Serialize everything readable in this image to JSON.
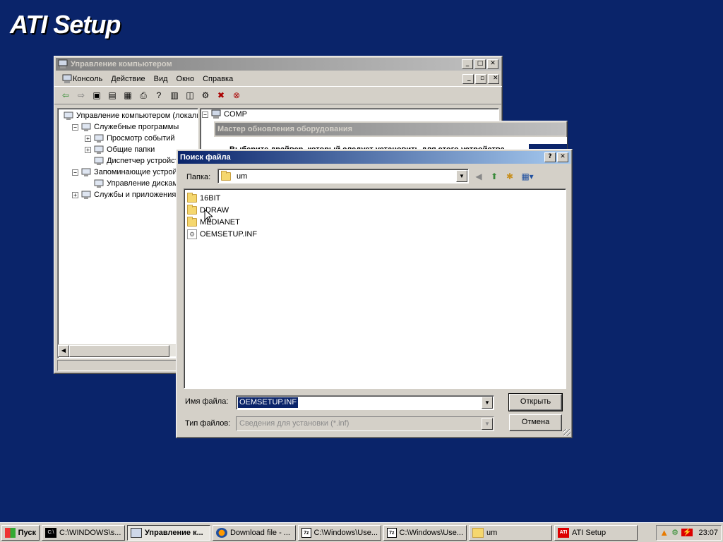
{
  "desktop": {
    "banner": "ATI Setup"
  },
  "mmc": {
    "title": "Управление компьютером",
    "menu": [
      "Консоль",
      "Действие",
      "Вид",
      "Окно",
      "Справка"
    ],
    "tree": [
      {
        "label": "Управление компьютером (локаль",
        "level": 0,
        "expander": ""
      },
      {
        "label": "Служебные программы",
        "level": 1,
        "expander": "−"
      },
      {
        "label": "Просмотр событий",
        "level": 2,
        "expander": "+"
      },
      {
        "label": "Общие папки",
        "level": 2,
        "expander": "+"
      },
      {
        "label": "Диспетчер устройств",
        "level": 2,
        "expander": ""
      },
      {
        "label": "Запоминающие устройства",
        "level": 1,
        "expander": "−"
      },
      {
        "label": "Управление дисками",
        "level": 2,
        "expander": ""
      },
      {
        "label": "Службы и приложения",
        "level": 1,
        "expander": "+"
      }
    ],
    "right_root": "COMP"
  },
  "wizard": {
    "title": "Мастер обновления оборудования",
    "text": "Выберите драйвер, который следует установить для этого устройства"
  },
  "dialog": {
    "title": "Поиск файла",
    "help": "?",
    "close": "✕",
    "folder_label": "Папка:",
    "folder_value": "um",
    "files": [
      {
        "name": "16BIT",
        "type": "folder"
      },
      {
        "name": "DDRAW",
        "type": "folder"
      },
      {
        "name": "MEDIANET",
        "type": "folder"
      },
      {
        "name": "OEMSETUP.INF",
        "type": "inf"
      }
    ],
    "filename_label": "Имя файла:",
    "filename_value": "OEMSETUP.INF",
    "filetype_label": "Тип файлов:",
    "filetype_value": "Сведения для установки (*.inf)",
    "open_button": "Открыть",
    "cancel_button": "Отмена"
  },
  "taskbar": {
    "start": "Пуск",
    "items": [
      {
        "label": "C:\\WINDOWS\\s...",
        "icon": "C:\\"
      },
      {
        "label": "Управление к...",
        "icon": "mmc",
        "active": true
      },
      {
        "label": "Download file - ...",
        "icon": "ff"
      },
      {
        "label": "C:\\Windows\\Use...",
        "icon": "7z"
      },
      {
        "label": "C:\\Windows\\Use...",
        "icon": "7z"
      },
      {
        "label": "um",
        "icon": "folder"
      },
      {
        "label": "ATI Setup",
        "icon": "ati"
      }
    ],
    "clock": "23:07"
  },
  "colors": {
    "desktop": "#0a246a",
    "titlebar": "#0a246a",
    "face": "#d4d0c8",
    "select": "#0a246a"
  }
}
